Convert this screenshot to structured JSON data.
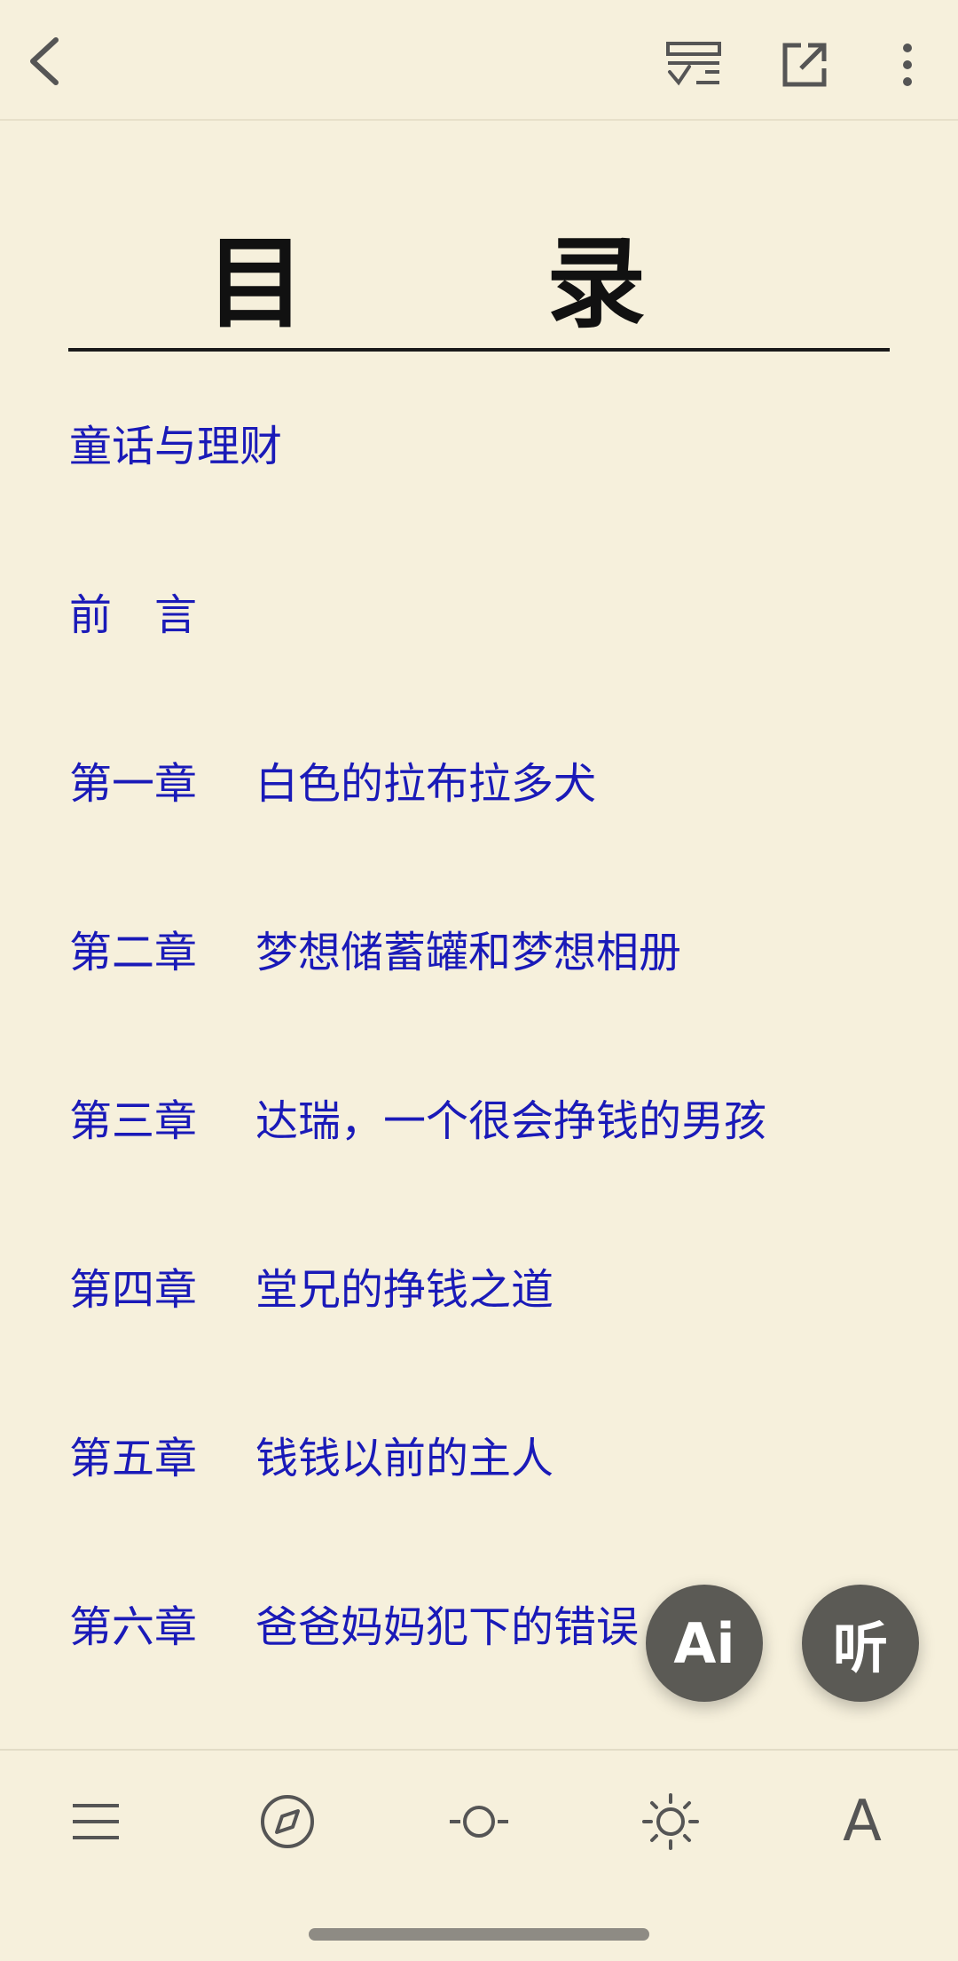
{
  "toc": {
    "title": "目　录",
    "items": [
      {
        "num": "",
        "title": "童话与理财"
      },
      {
        "num": "",
        "title": "前　言"
      },
      {
        "num": "第一章",
        "title": "白色的拉布拉多犬"
      },
      {
        "num": "第二章",
        "title": "梦想储蓄罐和梦想相册"
      },
      {
        "num": "第三章",
        "title": "达瑞，一个很会挣钱的男孩"
      },
      {
        "num": "第四章",
        "title": "堂兄的挣钱之道"
      },
      {
        "num": "第五章",
        "title": "钱钱以前的主人"
      },
      {
        "num": "第六章",
        "title": "爸爸妈妈犯下的错误"
      }
    ]
  },
  "fabs": {
    "ai_label": "Ai",
    "listen_label": "听"
  },
  "bottom": {
    "font_label": "A"
  },
  "icons": {
    "back": "chevron-left-icon",
    "bookmark_check": "bookmark-check-icon",
    "share": "external-link-icon",
    "more": "more-vertical-icon",
    "menu": "menu-icon",
    "compass": "compass-icon",
    "progress": "progress-icon",
    "brightness": "brightness-icon",
    "font": "font-size-icon"
  },
  "colors": {
    "background": "#f6f0dc",
    "link": "#1a1ab8",
    "fab": "#5b5a55"
  }
}
